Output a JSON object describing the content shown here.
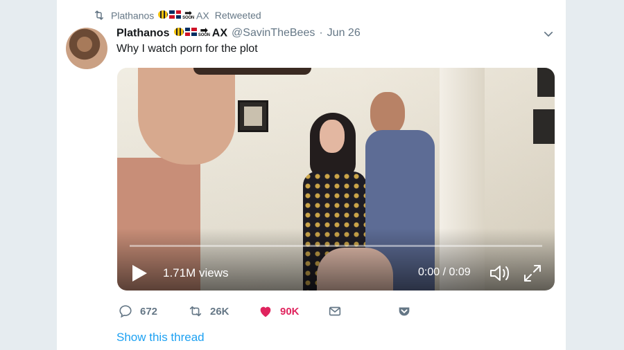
{
  "retweet_row": {
    "name_prefix": "Plathanos",
    "name_suffix": "AX",
    "retweeted_label": "Retweeted",
    "soon_label": "SOON"
  },
  "tweet": {
    "display_name": "Plathanos",
    "name_suffix": "AX",
    "soon_label": "SOON",
    "handle": "@SavinTheBees",
    "separator": "·",
    "date": "Jun 26",
    "text": "Why I watch porn for the plot"
  },
  "video": {
    "views": "1.71M views",
    "time": "0:00 / 0:09",
    "progress": 0.0
  },
  "actions": {
    "replies": "672",
    "retweets": "26K",
    "likes": "90K"
  },
  "show_thread": "Show this thread",
  "colors": {
    "accent": "#1da1f2",
    "like": "#e0245e",
    "muted": "#657786"
  }
}
